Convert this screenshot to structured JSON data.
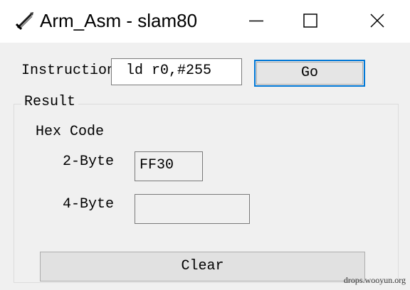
{
  "window": {
    "title": "Arm_Asm - slam80",
    "icons": {
      "app": "sword-icon",
      "minimize": "minimize-icon",
      "maximize": "maximize-icon",
      "close": "close-icon"
    }
  },
  "instruction": {
    "label": "Instruction:",
    "value": "ld r0,#255",
    "go_label": "Go"
  },
  "result": {
    "legend": "Result",
    "hex_code_label": "Hex Code",
    "two_byte_label": "2-Byte",
    "two_byte_value": "FF30",
    "four_byte_label": "4-Byte",
    "four_byte_value": ""
  },
  "clear_label": "Clear",
  "watermark": "drops.wooyun.org",
  "colors": {
    "focus_accent": "#0078d7",
    "window_bg": "#f0f0f0",
    "titlebar_bg": "#ffffff"
  }
}
